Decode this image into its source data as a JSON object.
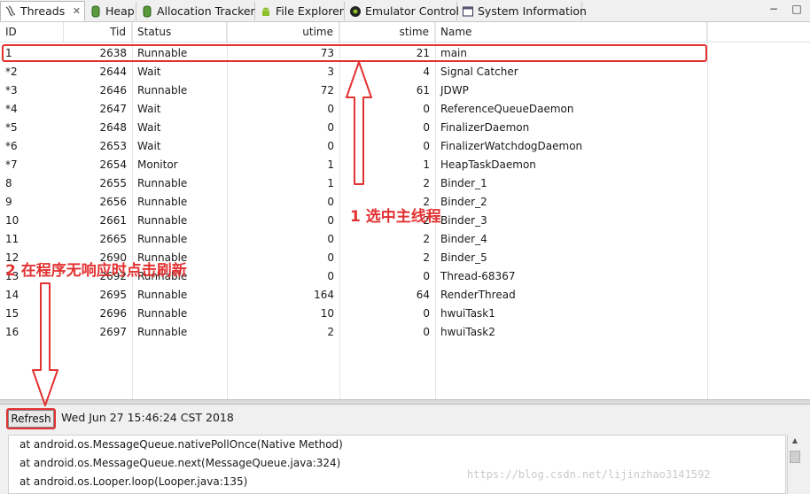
{
  "tabs": [
    {
      "label": "Threads",
      "icon": "threads-icon",
      "active": true,
      "closable": true
    },
    {
      "label": "Heap",
      "icon": "heap-icon"
    },
    {
      "label": "Allocation Tracker",
      "icon": "allocation-icon"
    },
    {
      "label": "File Explorer",
      "icon": "android-icon"
    },
    {
      "label": "Emulator Control",
      "icon": "emulator-icon"
    },
    {
      "label": "System Information",
      "icon": "system-info-icon"
    }
  ],
  "window_controls": {
    "minimize": "−",
    "maximize": "□"
  },
  "table": {
    "columns": [
      "ID",
      "Tid",
      "Status",
      "utime",
      "stime",
      "Name"
    ],
    "rows": [
      [
        "1",
        "2638",
        "Runnable",
        "73",
        "21",
        "main"
      ],
      [
        "*2",
        "2644",
        "Wait",
        "3",
        "4",
        "Signal Catcher"
      ],
      [
        "*3",
        "2646",
        "Runnable",
        "72",
        "61",
        "JDWP"
      ],
      [
        "*4",
        "2647",
        "Wait",
        "0",
        "0",
        "ReferenceQueueDaemon"
      ],
      [
        "*5",
        "2648",
        "Wait",
        "0",
        "0",
        "FinalizerDaemon"
      ],
      [
        "*6",
        "2653",
        "Wait",
        "0",
        "0",
        "FinalizerWatchdogDaemon"
      ],
      [
        "*7",
        "2654",
        "Monitor",
        "1",
        "1",
        "HeapTaskDaemon"
      ],
      [
        "8",
        "2655",
        "Runnable",
        "1",
        "2",
        "Binder_1"
      ],
      [
        "9",
        "2656",
        "Runnable",
        "0",
        "2",
        "Binder_2"
      ],
      [
        "10",
        "2661",
        "Runnable",
        "0",
        "2",
        "Binder_3"
      ],
      [
        "11",
        "2665",
        "Runnable",
        "0",
        "2",
        "Binder_4"
      ],
      [
        "12",
        "2690",
        "Runnable",
        "0",
        "2",
        "Binder_5"
      ],
      [
        "13",
        "2692",
        "Runnable",
        "0",
        "0",
        "Thread-68367"
      ],
      [
        "14",
        "2695",
        "Runnable",
        "164",
        "64",
        "RenderThread"
      ],
      [
        "15",
        "2696",
        "Runnable",
        "10",
        "0",
        "hwuiTask1"
      ],
      [
        "16",
        "2697",
        "Runnable",
        "2",
        "0",
        "hwuiTask2"
      ]
    ]
  },
  "bottom": {
    "refresh_label": "Refresh",
    "timestamp": "Wed Jun 27 15:46:24 CST 2018",
    "stack_lines": [
      "at android.os.MessageQueue.nativePollOnce(Native Method)",
      "at android.os.MessageQueue.next(MessageQueue.java:324)",
      "at android.os.Looper.loop(Looper.java:135)"
    ]
  },
  "annotations": {
    "note1": "1 选中主线程",
    "note2": "2 在程序无响应时点击刷新",
    "color": "#e23232"
  },
  "watermark": "https://blog.csdn.net/lijinzhao3141592"
}
